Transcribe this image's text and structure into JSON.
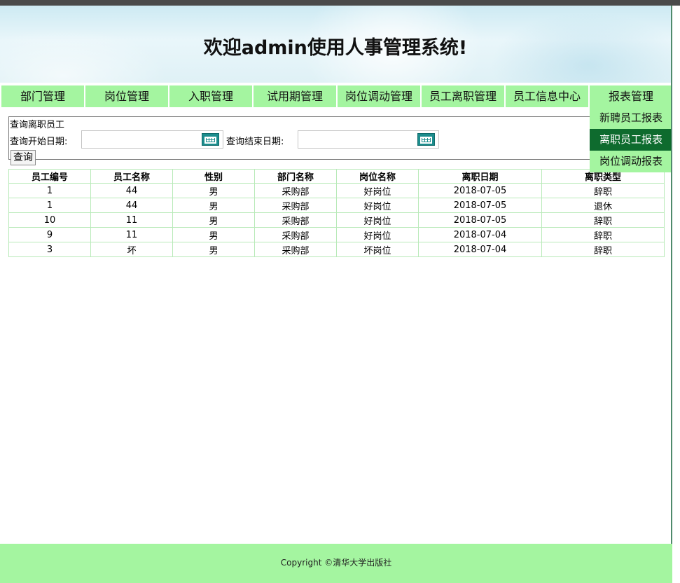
{
  "banner": {
    "title": "欢迎admin使用人事管理系统!"
  },
  "nav": {
    "items": [
      {
        "label": "部门管理"
      },
      {
        "label": "岗位管理"
      },
      {
        "label": "入职管理"
      },
      {
        "label": "试用期管理"
      },
      {
        "label": "岗位调动管理"
      },
      {
        "label": "员工离职管理"
      },
      {
        "label": "员工信息中心"
      },
      {
        "label": "报表管理"
      }
    ]
  },
  "dropdown": {
    "items": [
      {
        "label": "新聘员工报表",
        "active": false
      },
      {
        "label": "离职员工报表",
        "active": true
      },
      {
        "label": "岗位调动报表",
        "active": false
      }
    ]
  },
  "query": {
    "legend": "查询离职员工",
    "start_label": "查询开始日期:",
    "start_value": "",
    "end_label": "查询结束日期:",
    "end_value": "",
    "button_label": "查询"
  },
  "table": {
    "headers": [
      "员工编号",
      "员工名称",
      "性别",
      "部门名称",
      "岗位名称",
      "离职日期",
      "离职类型"
    ],
    "rows": [
      [
        "1",
        "44",
        "男",
        "采购部",
        "好岗位",
        "2018-07-05",
        "辞职"
      ],
      [
        "1",
        "44",
        "男",
        "采购部",
        "好岗位",
        "2018-07-05",
        "退休"
      ],
      [
        "10",
        "11",
        "男",
        "采购部",
        "好岗位",
        "2018-07-05",
        "辞职"
      ],
      [
        "9",
        "11",
        "男",
        "采购部",
        "好岗位",
        "2018-07-04",
        "辞职"
      ],
      [
        "3",
        "坏",
        "男",
        "采购部",
        "坏岗位",
        "2018-07-04",
        "辞职"
      ]
    ]
  },
  "footer": {
    "copyright": "Copyright ©清华大学出版社"
  },
  "colors": {
    "nav_bg": "#a4f5a0",
    "dropdown_active_bg": "#0e6b2e",
    "table_border": "#b9eab9",
    "calendar_icon": "#1c8d8d"
  }
}
